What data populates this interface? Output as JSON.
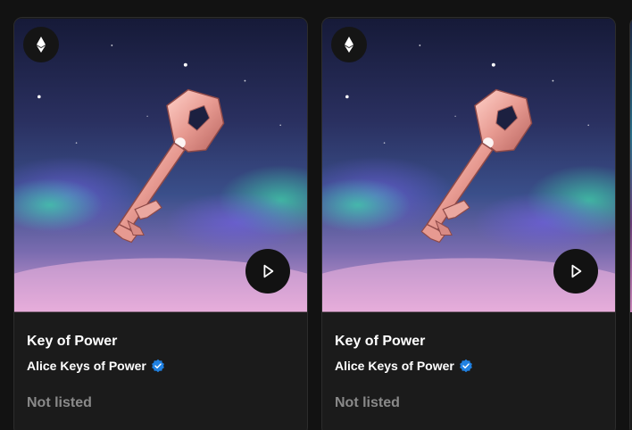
{
  "cards": [
    {
      "title": "Key of Power",
      "creator": "Alice Keys of Power",
      "status": "Not listed",
      "chain_icon": "ethereum-icon",
      "media_icon": "play-icon",
      "verified_icon": "verified-badge-icon"
    },
    {
      "title": "Key of Power",
      "creator": "Alice Keys of Power",
      "status": "Not listed",
      "chain_icon": "ethereum-icon",
      "media_icon": "play-icon",
      "verified_icon": "verified-badge-icon"
    }
  ],
  "colors": {
    "background": "#121212",
    "card": "#1b1b1b",
    "verified": "#2081e2",
    "status_text": "#8a8a8a",
    "key": "#e8a09a"
  }
}
